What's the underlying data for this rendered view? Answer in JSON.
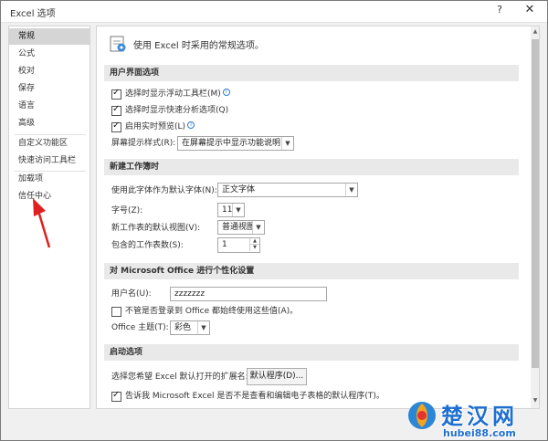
{
  "window": {
    "title": "Excel 选项",
    "help_label": "?",
    "close_label": "✕"
  },
  "sidebar": {
    "items": [
      {
        "label": "常规",
        "selected": true
      },
      {
        "label": "公式"
      },
      {
        "label": "校对"
      },
      {
        "label": "保存"
      },
      {
        "label": "语言"
      },
      {
        "label": "高级"
      },
      {
        "label": "自定义功能区"
      },
      {
        "label": "快速访问工具栏"
      },
      {
        "label": "加载项"
      },
      {
        "label": "信任中心"
      }
    ]
  },
  "header": {
    "text": "使用 Excel 时采用的常规选项。"
  },
  "ui_options": {
    "title": "用户界面选项",
    "mini_toolbar": {
      "label": "选择时显示浮动工具栏(M)",
      "checked": true
    },
    "quick_analysis": {
      "label": "选择时显示快速分析选项(Q)",
      "checked": true
    },
    "live_preview": {
      "label": "启用实时预览(L)",
      "checked": true
    },
    "screentip_label": "屏幕提示样式(R):",
    "screentip_value": "在屏幕提示中显示功能说明"
  },
  "new_workbook": {
    "title": "新建工作簿时",
    "font_label": "使用此字体作为默认字体(N):",
    "font_value": "正文字体",
    "size_label": "字号(Z):",
    "size_value": "11",
    "view_label": "新工作表的默认视图(V):",
    "view_value": "普通视图",
    "sheets_label": "包含的工作表数(S):",
    "sheets_value": "1"
  },
  "personalize": {
    "title": "对 Microsoft Office 进行个性化设置",
    "username_label": "用户名(U):",
    "username_value": "zzzzzzz",
    "always_use": {
      "label": "不管是否登录到 Office 都始终使用这些值(A)。",
      "checked": false
    },
    "theme_label": "Office 主题(T):",
    "theme_value": "彩色"
  },
  "startup": {
    "title": "启动选项",
    "ext_label": "选择您希望 Excel 默认打开的扩展名:",
    "default_programs_button": "默认程序(D)...",
    "tell_me": {
      "label": "告诉我 Microsoft Excel 是否不是查看和编辑电子表格的默认程序(T)。",
      "checked": true
    }
  },
  "watermark": {
    "title": "楚汉网",
    "url": "hubei88.com"
  },
  "colors": {
    "selected_bg": "#d5d5d5",
    "section_bg": "#e9e9e9",
    "annotation_arrow": "#e02020",
    "watermark_blue": "#1e6fd0"
  }
}
